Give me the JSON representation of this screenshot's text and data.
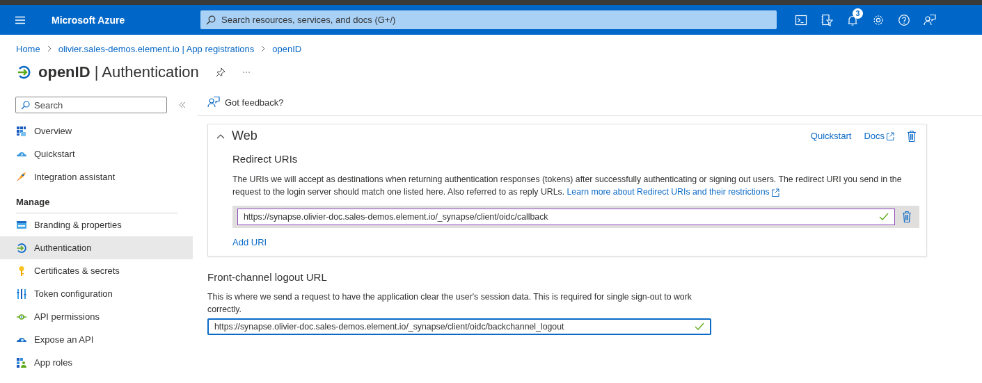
{
  "header": {
    "brand": "Microsoft Azure",
    "search": {
      "placeholder": "Search resources, services, and docs (G+/)"
    },
    "notifications": "3"
  },
  "breadcrumb": [
    "Home",
    "olivier.sales-demos.element.io | App registrations",
    "openID"
  ],
  "page_title": {
    "name": "openID",
    "separator": "|",
    "section": "Authentication"
  },
  "sidebar": {
    "search": {
      "placeholder": "Search"
    },
    "items": [
      {
        "label": "Overview",
        "kind": "item",
        "selected": false
      },
      {
        "label": "Quickstart",
        "kind": "item",
        "selected": false
      },
      {
        "label": "Integration assistant",
        "kind": "item",
        "selected": false
      },
      {
        "label": "Manage",
        "kind": "section"
      },
      {
        "label": "Branding & properties",
        "kind": "item",
        "selected": false
      },
      {
        "label": "Authentication",
        "kind": "item",
        "selected": true
      },
      {
        "label": "Certificates & secrets",
        "kind": "item",
        "selected": false
      },
      {
        "label": "Token configuration",
        "kind": "item",
        "selected": false
      },
      {
        "label": "API permissions",
        "kind": "item",
        "selected": false
      },
      {
        "label": "Expose an API",
        "kind": "item",
        "selected": false
      },
      {
        "label": "App roles",
        "kind": "item",
        "selected": false
      }
    ]
  },
  "toolbar": {
    "feedback": "Got feedback?"
  },
  "web_panel": {
    "title": "Web",
    "expanded": true,
    "links": [
      "Quickstart",
      "Docs"
    ],
    "heading": "Redirect URIs",
    "description": "The URIs we will accept as destinations when returning authentication responses (tokens) after successfully authenticating or signing out users. The redirect URI you send in the request to the login server should match one listed here. Also referred to as reply URLs.",
    "learn_more": "Learn more about Redirect URIs and their restrictions",
    "uris": [
      {
        "value": "https://synapse.olivier-doc.sales-demos.element.io/_synapse/client/oidc/callback",
        "valid": true
      }
    ],
    "add_uri": "Add URI"
  },
  "logout": {
    "heading": "Front-channel logout URL",
    "description": "This is where we send a request to have the application clear the user's session data. This is required for single sign-out to work correctly.",
    "value": "https://synapse.olivier-doc.sales-demos.element.io/_synapse/client/oidc/backchannel_logout",
    "valid": true
  }
}
